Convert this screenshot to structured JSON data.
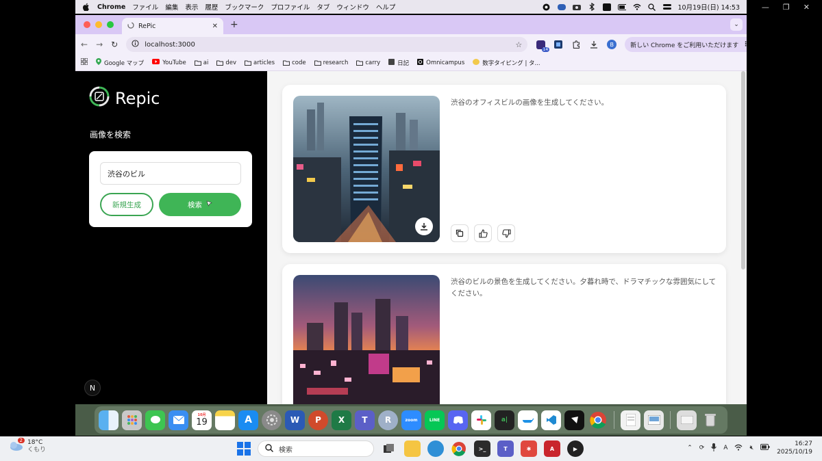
{
  "mac_menubar": {
    "app_name": "Chrome",
    "menus": [
      "ファイル",
      "編集",
      "表示",
      "履歴",
      "ブックマーク",
      "プロファイル",
      "タブ",
      "ウィンドウ",
      "ヘルプ"
    ],
    "datetime": "10月19日(日)  14:53"
  },
  "browser": {
    "tab_title": "RePic",
    "url": "localhost:3000",
    "extension_badge": "14",
    "profile_initial": "B",
    "chrome_banner": "新しい Chrome をご利用いただけます",
    "bookmarks": [
      "Google マップ",
      "YouTube",
      "ai",
      "dev",
      "articles",
      "code",
      "research",
      "carry",
      "日記",
      "Omnicampus",
      "数字タイピング | タ..."
    ]
  },
  "app": {
    "logo_text": "Repic",
    "search_title": "画像を検索",
    "search_value": "渋谷のビル",
    "new_button": "新規生成",
    "search_button": "検索",
    "next_badge": "N",
    "cards": [
      {
        "prompt": "渋谷のオフィスビルの画像を生成してください。"
      },
      {
        "prompt": "渋谷のビルの景色を生成してください。夕暮れ時で、ドラマチックな雰囲気にしてください。"
      }
    ]
  },
  "dock": {
    "calendar_month": "10月",
    "calendar_day": "19",
    "zoom_label": "zoom",
    "line_label": "LINE"
  },
  "taskbar": {
    "weather_badge": "2",
    "temperature": "18°C",
    "condition": "くもり",
    "search_placeholder": "検索",
    "time": "16:27",
    "date": "2025/10/19"
  },
  "colors": {
    "accent_green": "#3fb556",
    "tab_strip": "#d9c8f5"
  }
}
